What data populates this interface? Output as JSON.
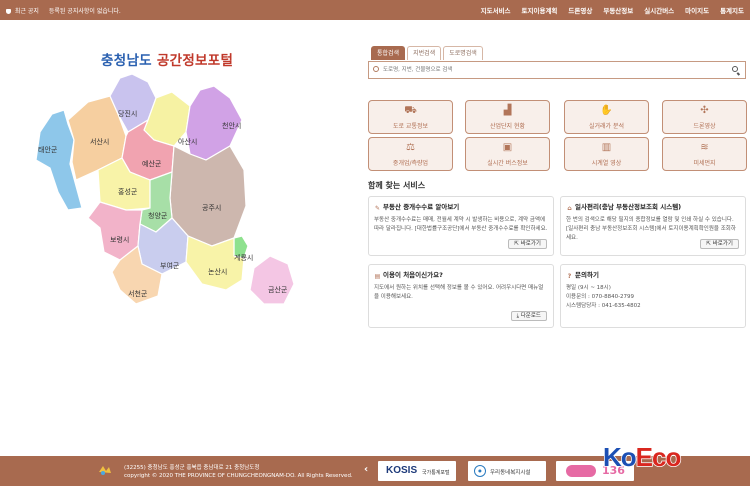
{
  "topbar": {
    "notice_label": "최근 공지",
    "notice_text": "등록된 공지사항이 없습니다.",
    "nav": [
      "지도서비스",
      "토지이용계획",
      "드론영상",
      "부동산정보",
      "실시간버스",
      "마이지도",
      "통계지도"
    ]
  },
  "title": {
    "main": "충청남도",
    "accent": "공간정보포털"
  },
  "map": {
    "regions": [
      {
        "name": "태안군",
        "color": "#8ec7ea"
      },
      {
        "name": "서산시",
        "color": "#f6cfa0"
      },
      {
        "name": "당진시",
        "color": "#c9c3ee"
      },
      {
        "name": "아산시",
        "color": "#f6f2a3"
      },
      {
        "name": "천안시",
        "color": "#d1a2e6"
      },
      {
        "name": "예산군",
        "color": "#f1a3b0"
      },
      {
        "name": "홍성군",
        "color": "#f8f3a8"
      },
      {
        "name": "공주시",
        "color": "#cdb7ae"
      },
      {
        "name": "청양군",
        "color": "#a7dfa7"
      },
      {
        "name": "보령시",
        "color": "#f2b3c9"
      },
      {
        "name": "부여군",
        "color": "#c9cdee"
      },
      {
        "name": "계룡시",
        "color": "#8ee18e"
      },
      {
        "name": "논산시",
        "color": "#f8f3a8"
      },
      {
        "name": "서천군",
        "color": "#f8d6b0"
      },
      {
        "name": "금산군",
        "color": "#f4c6e4"
      }
    ]
  },
  "search": {
    "tabs": [
      "통합검색",
      "지번검색",
      "도로명검색"
    ],
    "placeholder": "도로명, 지번, 건물명으로 검색"
  },
  "quick": [
    {
      "label": "도로 교통정보",
      "icon": "car-icon"
    },
    {
      "label": "산업단지 현황",
      "icon": "factory-icon"
    },
    {
      "label": "실거래가 분석",
      "icon": "handshake-icon"
    },
    {
      "label": "드론영상",
      "icon": "drone-icon"
    },
    {
      "label": "중개업/측량업",
      "icon": "scale-icon"
    },
    {
      "label": "실시간 버스정보",
      "icon": "bus-icon"
    },
    {
      "label": "시계열 영상",
      "icon": "map-icon"
    },
    {
      "label": "미세먼지",
      "icon": "dust-icon"
    }
  ],
  "services": {
    "title": "함께 찾는 서비스",
    "cards": [
      {
        "title": "부동산 중개수수료 알아보기",
        "body": "부동산 중개수수료는 매매, 전월세 계약 시 발생하는 비용으로, 계약 금액에 따라 달라집니다. [대한법률구조공단]에서 부동산 중개수수료를 확인하세요.",
        "button": "바로가기"
      },
      {
        "title": "일사편리(충남 부동산정보조회 시스템)",
        "body": "한 번의 검색으로 해당 필지의 종합정보를 열람 및 인쇄 하실 수 있습니다. [일사편리 충남 부동산정보조회 시스템]에서 토지이용계획확인원을 조회하세요.",
        "button": "바로가기"
      },
      {
        "title": "이용이 처음이신가요?",
        "body": "지도에서 원하는 위치를 선택해 정보를 볼 수 있어요. 어려우시다면 매뉴얼을 이용해보세요.",
        "button": "다운로드"
      },
      {
        "title": "문의하기",
        "lines": [
          "평일 (9시 ~ 18시)",
          "이용문의 : 070-8840-2799",
          "시스템담당자 : 041-635-4802"
        ]
      }
    ]
  },
  "footer": {
    "address": "(32255) 충청남도 홍성군 홍북읍 충남대로 21 충청남도청",
    "copyright": "copyright © 2020 THE PROVINCE OF CHUNGCHEONGNAM-DO. All Rights Reserved.",
    "prev": "‹",
    "partners": {
      "kosis": "KOSIS",
      "kosis_sub": "국가통계포털",
      "p2": "우리동네복지시설",
      "p3_num": "136"
    }
  },
  "watermark": {
    "ko": "Ko",
    "eco": "Eco"
  }
}
